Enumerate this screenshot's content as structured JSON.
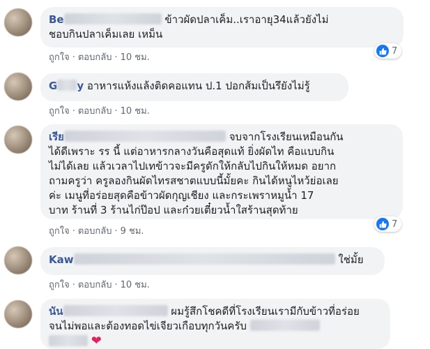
{
  "comments": [
    {
      "author": "Be",
      "text_lines": [
        "ข้าวผัดปลาเค็ม..เราอายุ34แล้วยังไม่",
        "ชอบกินปลาเค็มเลย เหม็น"
      ],
      "like": "ถูกใจ",
      "reply": "ตอบกลับ",
      "time": "10 ชม.",
      "reaction_count": "7"
    },
    {
      "author": "G",
      "author_suffix": "y",
      "text_lines": [
        "อาหารแห้งแล้งติดคอแทน ป.1 ปอกส้มเป็นรึยังไม่รู้"
      ],
      "like": "ถูกใจ",
      "reply": "ตอบกลับ",
      "time": "10 ชม."
    },
    {
      "author": "เรีย",
      "text_lines": [
        "จบจากโรงเรียนเหมือนกัน",
        "ได้ดีเพราะ รร นี้ แต่อาหารกลางวันคือสุดแท้ ยิ่งผัดไท คือแบบกิน",
        "ไม่ได้เลย แล้วเวลาไปเทข้าวจะมีครูดักให้กลับไปกินให้หมด อยาก",
        "ถามครูว่า ครูลองกินผัดไทรสชาตแบบนี้มั้ยคะ กินได้หนูไหว้ย่อเลย",
        "ค่ะ เมนูที่อร่อยสุดคือข้าวผัดกุญเชียง และกระเพราหมูน้ำ 17",
        "บาท ร้านที่ 3 ร้านไก่ป๊อป และก๋วยเตี๋ยวน้ำใสร้านสุดท้าย"
      ],
      "like": "ถูกใจ",
      "reply": "ตอบกลับ",
      "time": "9 ชม.",
      "reaction_count": "7"
    },
    {
      "author": "Kaw",
      "text_lines": [
        "ใช่มั้ย"
      ],
      "like": "ถูกใจ",
      "reply": "ตอบกลับ",
      "time": "10 ชม."
    },
    {
      "author": "นัน",
      "text_lines": [
        "ผมรู้สึกโชคดีที่โรงเรียนเรามีกับข้าวที่อร่อย",
        "จนไม่พอและต้องทอดไข่เจียวเกือบทุกวันครับ"
      ]
    }
  ],
  "colors": {
    "author": "#385898",
    "bubble": "#f2f3f5",
    "like": "#1877f2",
    "heart": "#e0245e"
  },
  "icons": {
    "reaction": "like-icon",
    "heart": "heart-icon"
  }
}
